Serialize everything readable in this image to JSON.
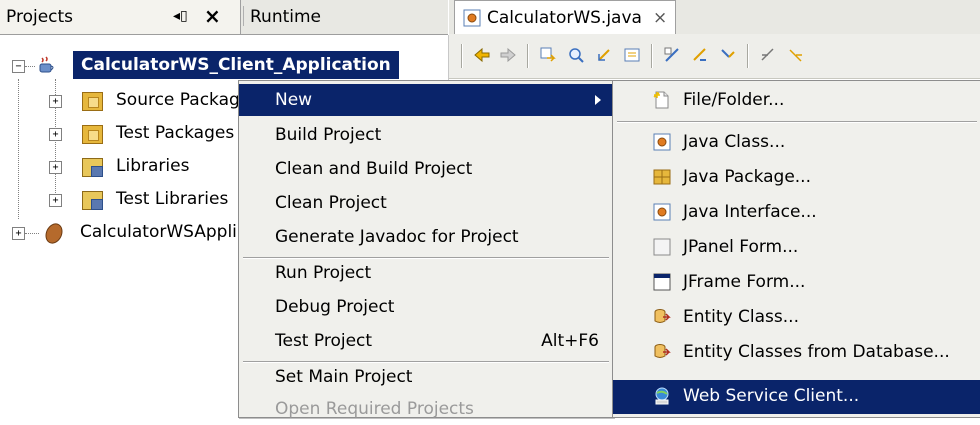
{
  "projects_panel": {
    "tab_projects": "Projects",
    "tab_runtime": "Runtime",
    "tree": {
      "root_project": "CalculatorWS_Client_Application",
      "children": [
        {
          "label": "Source Packag",
          "icon": "package-folder-icon"
        },
        {
          "label": "Test Packages",
          "icon": "package-folder-icon"
        },
        {
          "label": "Libraries",
          "icon": "library-icon"
        },
        {
          "label": "Test Libraries",
          "icon": "library-icon"
        }
      ],
      "second_project": "CalculatorWSAppli"
    }
  },
  "editor": {
    "tab_label": "CalculatorWS.java",
    "close_glyph": "×"
  },
  "context_menu": {
    "items": [
      {
        "label": "New",
        "selected": true,
        "submenu": true
      },
      {
        "label": "Build Project"
      },
      {
        "label": "Clean and Build Project"
      },
      {
        "label": "Clean Project"
      },
      {
        "label": "Generate Javadoc for Project"
      },
      {
        "label": "Run Project"
      },
      {
        "label": "Debug Project"
      },
      {
        "label": "Test Project",
        "shortcut": "Alt+F6"
      },
      {
        "label": "Set Main Project"
      },
      {
        "label": "Open Required Projects",
        "disabled": true
      }
    ]
  },
  "new_submenu": {
    "items": [
      {
        "label": "File/Folder...",
        "icon": "new-file-icon"
      },
      {
        "label": "Java Class...",
        "icon": "java-class-icon"
      },
      {
        "label": "Java Package...",
        "icon": "java-package-icon"
      },
      {
        "label": "Java Interface...",
        "icon": "java-interface-icon"
      },
      {
        "label": "JPanel Form...",
        "icon": "jpanel-form-icon"
      },
      {
        "label": "JFrame Form...",
        "icon": "jframe-form-icon"
      },
      {
        "label": "Entity Class...",
        "icon": "entity-class-icon"
      },
      {
        "label": "Entity Classes from Database...",
        "icon": "entity-database-icon"
      },
      {
        "label": "Web Service Client...",
        "icon": "web-service-client-icon",
        "selected": true
      }
    ]
  },
  "colors": {
    "selection": "#0a246a",
    "menu_bg": "#f0f0ec",
    "disabled_text": "#9a9a9a"
  }
}
